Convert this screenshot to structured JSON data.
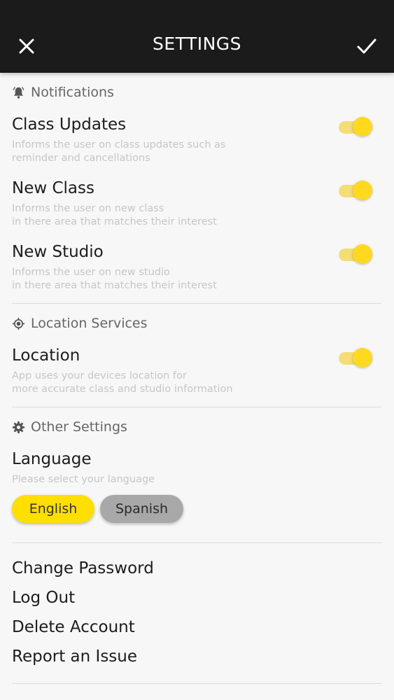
{
  "header": {
    "title": "SETTINGS"
  },
  "notifications": {
    "heading": "Notifications",
    "items": [
      {
        "title": "Class Updates",
        "desc1": "Informs the user on class updates such as",
        "desc2": "reminder and cancellations",
        "enabled": true
      },
      {
        "title": "New Class",
        "desc1": "Informs the user on new class",
        "desc2": "in there area that matches their interest",
        "enabled": true
      },
      {
        "title": "New Studio",
        "desc1": "Informs the user on new studio",
        "desc2": "in there area that matches their interest",
        "enabled": true
      }
    ]
  },
  "location": {
    "heading": "Location Services",
    "title": "Location",
    "desc1": "App uses your devices location for",
    "desc2": "more accurate class and studio information",
    "enabled": true
  },
  "other": {
    "heading": "Other Settings",
    "language_title": "Language",
    "language_desc": "Please select your language",
    "options": [
      "English",
      "Spanish"
    ],
    "selected": "English"
  },
  "links": [
    "Change Password",
    "Log Out",
    "Delete Account",
    "Report an Issue"
  ],
  "colors": {
    "accent": "#ffdf00",
    "toggle_track": "#f4dd76",
    "header_bg": "#1b1b1b",
    "unselected_pill": "#a8a8a8"
  },
  "icons": {
    "close": "close-icon",
    "confirm": "check-icon",
    "notifications": "bell-icon",
    "location": "location-target-icon",
    "other": "gear-icon"
  }
}
